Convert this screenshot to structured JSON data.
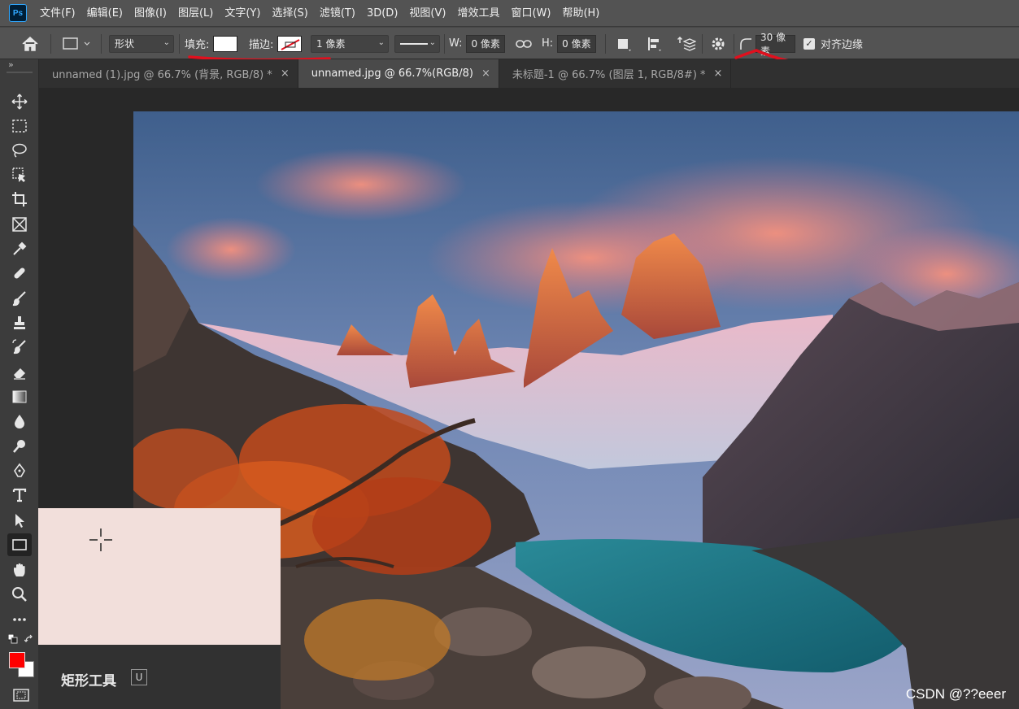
{
  "app": {
    "logo": "Ps"
  },
  "menu": [
    "文件(F)",
    "编辑(E)",
    "图像(I)",
    "图层(L)",
    "文字(Y)",
    "选择(S)",
    "滤镜(T)",
    "3D(D)",
    "视图(V)",
    "增效工具",
    "窗口(W)",
    "帮助(H)"
  ],
  "options": {
    "mode": "形状",
    "fill_label": "填充:",
    "stroke_label": "描边:",
    "stroke_width": "1 像素",
    "w_label": "W:",
    "w_value": "0 像素",
    "h_label": "H:",
    "h_value": "0 像素",
    "radius_value": "30 像素",
    "align_edges_label": "对齐边缘",
    "align_edges_checked": true,
    "fill_color": "#ffffff"
  },
  "tabs": [
    {
      "label": "unnamed (1).jpg @ 66.7% (背景, RGB/8) *",
      "close": "×",
      "active": false
    },
    {
      "label": "unnamed.jpg @ 66.7%(RGB/8)",
      "close": "×",
      "active": true
    },
    {
      "label": "未标题-1 @ 66.7% (图层 1, RGB/8#) *",
      "close": "×",
      "active": false
    }
  ],
  "toolbar": {
    "tools": [
      "move-icon",
      "marquee-icon",
      "lasso-icon",
      "object-select-icon",
      "crop-icon",
      "frame-icon",
      "eyedropper-icon",
      "healing-icon",
      "brush-icon",
      "stamp-icon",
      "history-brush-icon",
      "eraser-icon",
      "gradient-icon",
      "blur-icon",
      "dodge-icon",
      "pen-icon",
      "type-icon",
      "path-select-icon",
      "rectangle-icon",
      "hand-icon",
      "zoom-icon",
      "more-icon"
    ],
    "active_tool": "rectangle-icon",
    "foreground_color": "#ff0000",
    "background_color": "#ffffff"
  },
  "tooltip": {
    "title": "矩形工具",
    "shortcut": "U"
  },
  "watermark": "CSDN @??eeer",
  "annotation_color": "#e0101e"
}
